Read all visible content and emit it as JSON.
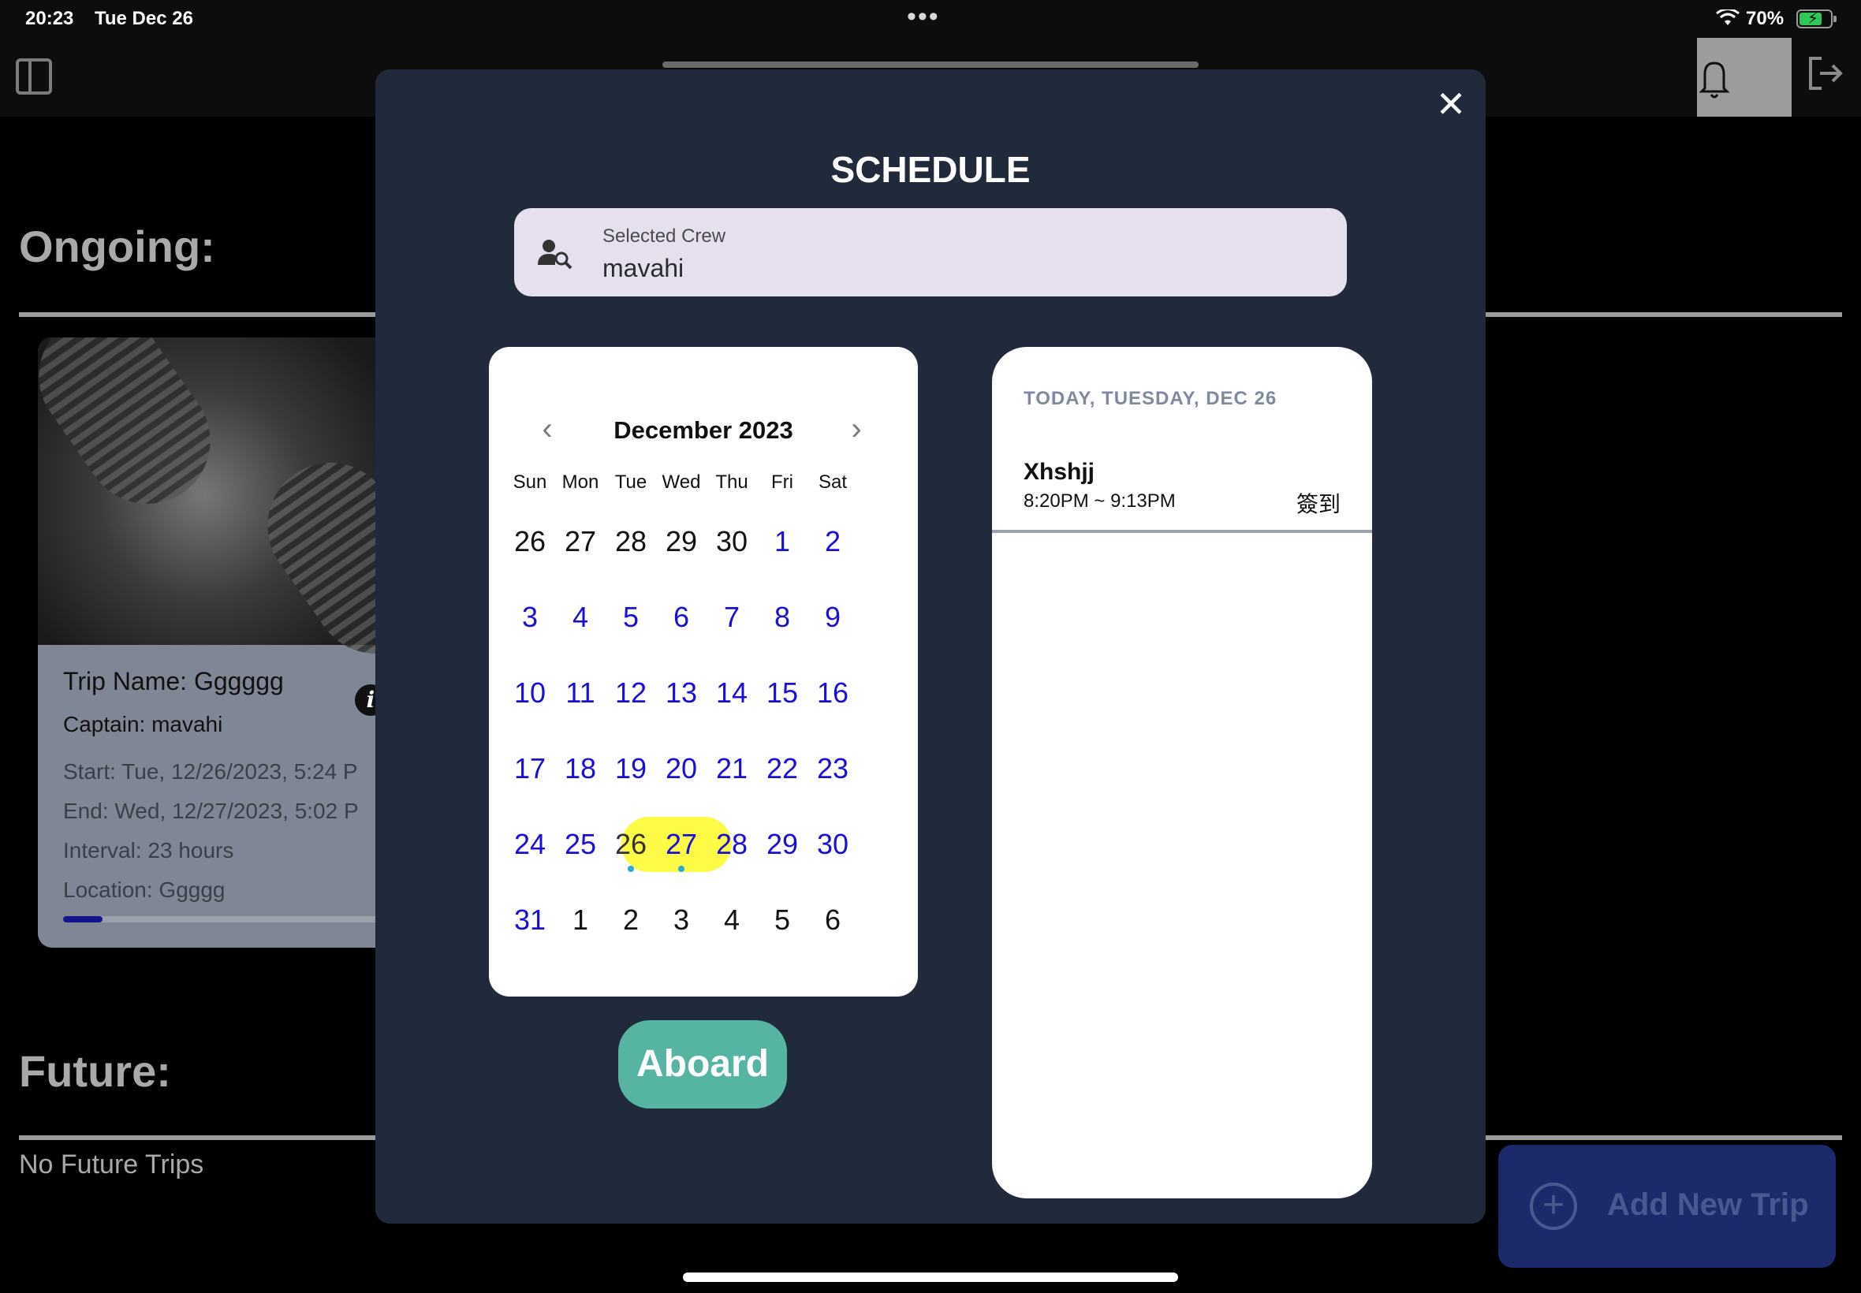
{
  "status_bar": {
    "time": "20:23",
    "date": "Tue Dec 26",
    "battery": "70%"
  },
  "background": {
    "ongoing_heading": "Ongoing:",
    "future_heading": "Future:",
    "no_future_text": "No Future Trips",
    "add_trip_label": "Add New Trip",
    "trip_card": {
      "name": "Trip Name: Gggggg",
      "captain": "Captain: mavahi",
      "start": "Start: Tue, 12/26/2023, 5:24 P",
      "end": "End: Wed, 12/27/2023, 5:02 P",
      "interval": "Interval: 23 hours",
      "location": "Location: Ggggg",
      "progress": 0.12
    }
  },
  "modal": {
    "title": "SCHEDULE",
    "crew_field": {
      "label": "Selected Crew",
      "value": "mavahi"
    },
    "calendar": {
      "month_label": "December 2023",
      "weekdays": [
        "Sun",
        "Mon",
        "Tue",
        "Wed",
        "Thu",
        "Fri",
        "Sat"
      ],
      "weeks": [
        [
          "26",
          "27",
          "28",
          "29",
          "30",
          "1",
          "2"
        ],
        [
          "3",
          "4",
          "5",
          "6",
          "7",
          "8",
          "9"
        ],
        [
          "10",
          "11",
          "12",
          "13",
          "14",
          "15",
          "16"
        ],
        [
          "17",
          "18",
          "19",
          "20",
          "21",
          "22",
          "23"
        ],
        [
          "24",
          "25",
          "26",
          "27",
          "28",
          "29",
          "30"
        ],
        [
          "31",
          "1",
          "2",
          "3",
          "4",
          "5",
          "6"
        ]
      ]
    },
    "aboard_label": "Aboard",
    "agenda": {
      "header": "TODAY, TUESDAY, DEC 26",
      "item": {
        "title": "Xhshjj",
        "time": "8:20PM ~ 9:13PM",
        "action": "簽到"
      }
    }
  }
}
